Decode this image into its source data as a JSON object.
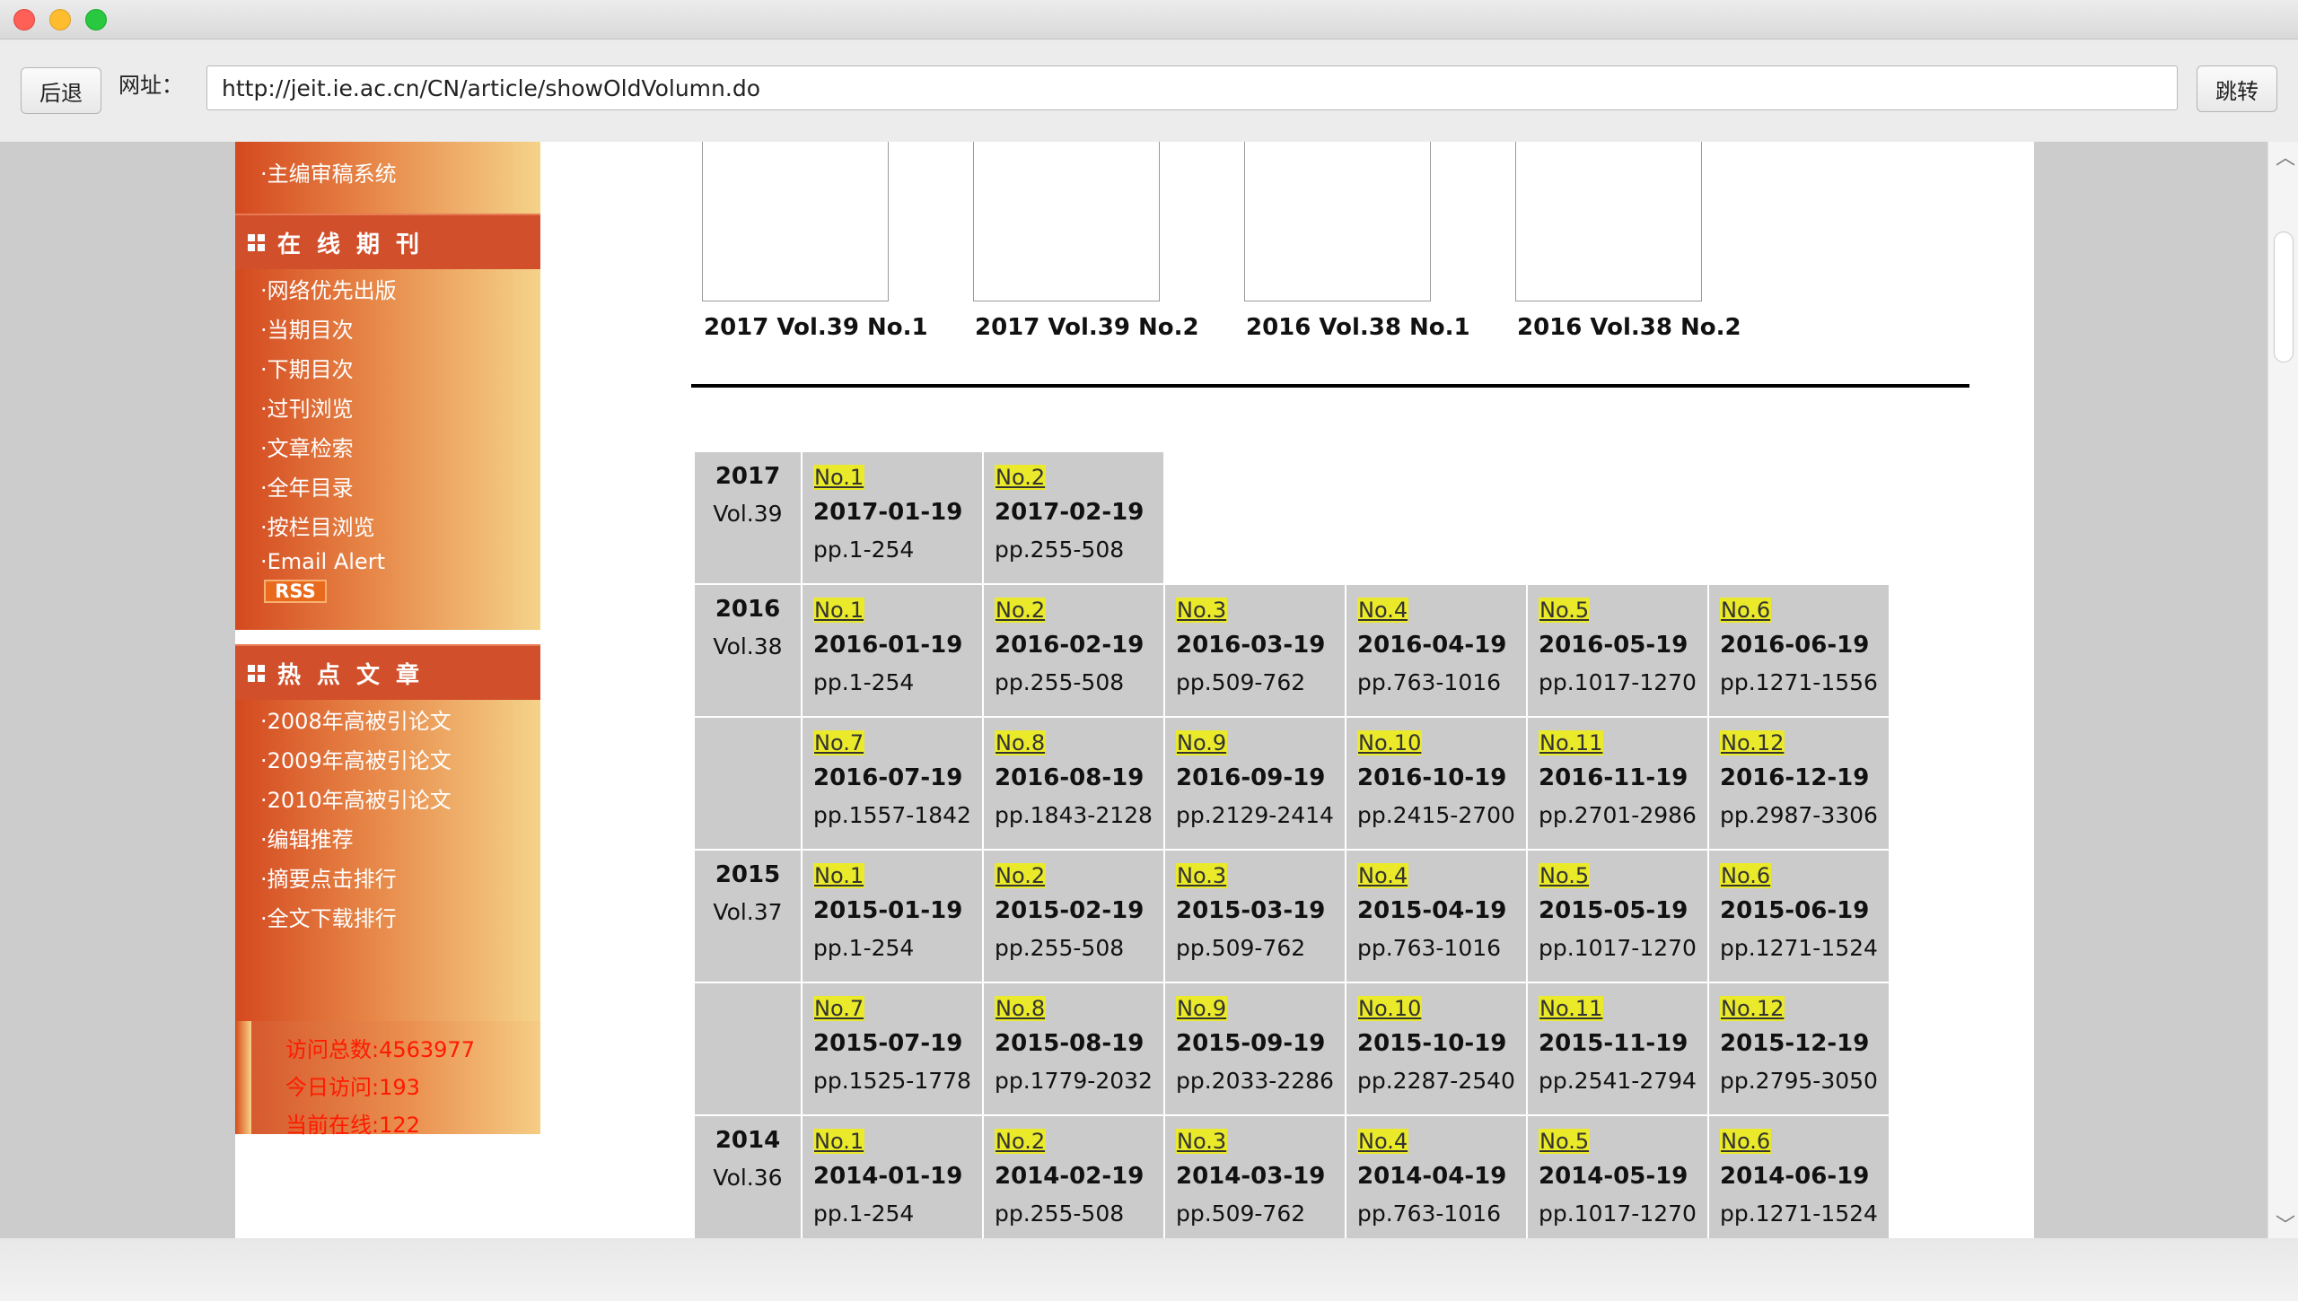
{
  "toolbar": {
    "back_label": "后退",
    "url_label": "网址：",
    "url_value": "http://jeit.ie.ac.cn/CN/article/showOldVolumn.do",
    "go_label": "跳转"
  },
  "sidebar": {
    "top_link": "·主编审稿系统",
    "online_journal_title": "在线期刊",
    "online_journal_links": [
      "·网络优先出版",
      "·当期目次",
      "·下期目次",
      "·过刊浏览",
      "·文章检索",
      "·全年目录",
      "·按栏目浏览",
      "·Email Alert"
    ],
    "rss_label": "RSS",
    "hot_articles_title": "热点文章",
    "hot_article_links": [
      "·2008年高被引论文",
      "·2009年高被引论文",
      "·2010年高被引论文",
      "·编辑推荐",
      "·摘要点击排行",
      "·全文下载排行"
    ],
    "stats": [
      "访问总数:4563977",
      "今日访问:193",
      "当前在线:122"
    ]
  },
  "covers": [
    "2017 Vol.39 No.1",
    "2017 Vol.39 No.2",
    "2016 Vol.38 No.1",
    "2016 Vol.38 No.2"
  ],
  "volumes": [
    {
      "year": "2017",
      "vol": "Vol.39",
      "issues": [
        {
          "no": "No.1",
          "date": "2017-01-19",
          "pp": "pp.1-254"
        },
        {
          "no": "No.2",
          "date": "2017-02-19",
          "pp": "pp.255-508"
        }
      ]
    },
    {
      "year": "2016",
      "vol": "Vol.38",
      "issues": [
        {
          "no": "No.1",
          "date": "2016-01-19",
          "pp": "pp.1-254"
        },
        {
          "no": "No.2",
          "date": "2016-02-19",
          "pp": "pp.255-508"
        },
        {
          "no": "No.3",
          "date": "2016-03-19",
          "pp": "pp.509-762"
        },
        {
          "no": "No.4",
          "date": "2016-04-19",
          "pp": "pp.763-1016"
        },
        {
          "no": "No.5",
          "date": "2016-05-19",
          "pp": "pp.1017-1270"
        },
        {
          "no": "No.6",
          "date": "2016-06-19",
          "pp": "pp.1271-1556"
        },
        {
          "no": "No.7",
          "date": "2016-07-19",
          "pp": "pp.1557-1842"
        },
        {
          "no": "No.8",
          "date": "2016-08-19",
          "pp": "pp.1843-2128"
        },
        {
          "no": "No.9",
          "date": "2016-09-19",
          "pp": "pp.2129-2414"
        },
        {
          "no": "No.10",
          "date": "2016-10-19",
          "pp": "pp.2415-2700"
        },
        {
          "no": "No.11",
          "date": "2016-11-19",
          "pp": "pp.2701-2986"
        },
        {
          "no": "No.12",
          "date": "2016-12-19",
          "pp": "pp.2987-3306"
        }
      ]
    },
    {
      "year": "2015",
      "vol": "Vol.37",
      "issues": [
        {
          "no": "No.1",
          "date": "2015-01-19",
          "pp": "pp.1-254"
        },
        {
          "no": "No.2",
          "date": "2015-02-19",
          "pp": "pp.255-508"
        },
        {
          "no": "No.3",
          "date": "2015-03-19",
          "pp": "pp.509-762"
        },
        {
          "no": "No.4",
          "date": "2015-04-19",
          "pp": "pp.763-1016"
        },
        {
          "no": "No.5",
          "date": "2015-05-19",
          "pp": "pp.1017-1270"
        },
        {
          "no": "No.6",
          "date": "2015-06-19",
          "pp": "pp.1271-1524"
        },
        {
          "no": "No.7",
          "date": "2015-07-19",
          "pp": "pp.1525-1778"
        },
        {
          "no": "No.8",
          "date": "2015-08-19",
          "pp": "pp.1779-2032"
        },
        {
          "no": "No.9",
          "date": "2015-09-19",
          "pp": "pp.2033-2286"
        },
        {
          "no": "No.10",
          "date": "2015-10-19",
          "pp": "pp.2287-2540"
        },
        {
          "no": "No.11",
          "date": "2015-11-19",
          "pp": "pp.2541-2794"
        },
        {
          "no": "No.12",
          "date": "2015-12-19",
          "pp": "pp.2795-3050"
        }
      ]
    },
    {
      "year": "2014",
      "vol": "Vol.36",
      "issues": [
        {
          "no": "No.1",
          "date": "2014-01-19",
          "pp": "pp.1-254"
        },
        {
          "no": "No.2",
          "date": "2014-02-19",
          "pp": "pp.255-508"
        },
        {
          "no": "No.3",
          "date": "2014-03-19",
          "pp": "pp.509-762"
        },
        {
          "no": "No.4",
          "date": "2014-04-19",
          "pp": "pp.763-1016"
        },
        {
          "no": "No.5",
          "date": "2014-05-19",
          "pp": "pp.1017-1270"
        },
        {
          "no": "No.6",
          "date": "2014-06-19",
          "pp": "pp.1271-1524"
        }
      ]
    }
  ],
  "icons": {
    "window_close": "close-icon",
    "window_minimize": "minimize-icon",
    "window_maximize": "maximize-icon",
    "section_marker": "grid-icon",
    "scroll_up": "chevron-up-icon",
    "scroll_down": "chevron-down-icon"
  },
  "colors": {
    "sidebar_header": "#d14f2b",
    "issue_highlight": "#eaea2a",
    "stats_text": "#ff1a00",
    "table_cell": "#cbcbcb"
  }
}
